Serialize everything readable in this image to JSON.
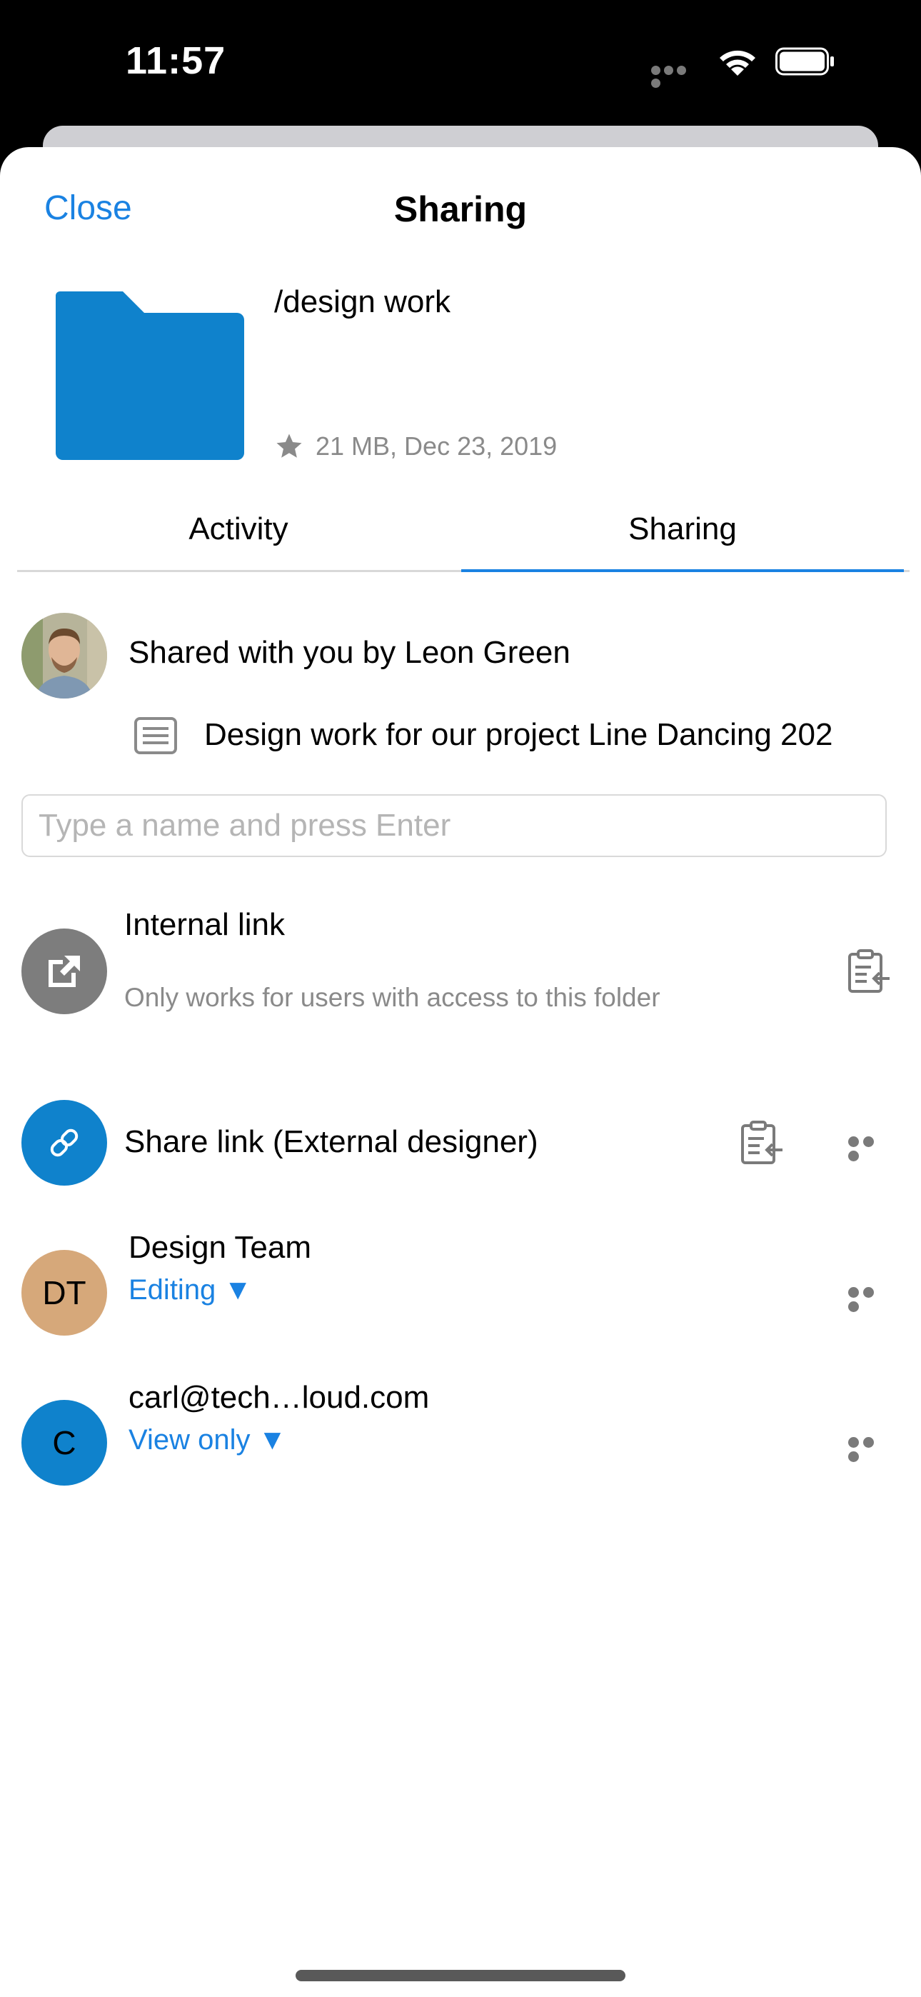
{
  "status_bar": {
    "time": "11:57"
  },
  "header": {
    "close_label": "Close",
    "title": "Sharing"
  },
  "file": {
    "name": "/design work",
    "meta": "21 MB, Dec 23, 2019",
    "folder_color": "#0f82cc"
  },
  "tabs": [
    {
      "label": "Activity",
      "selected": false
    },
    {
      "label": "Sharing",
      "selected": true
    }
  ],
  "share_info": {
    "shared_by": "Shared with you by Leon Green",
    "note": "Design work for our project Line Dancing 202"
  },
  "search": {
    "placeholder": "Type a name and press Enter"
  },
  "internal_link": {
    "title": "Internal link",
    "subtitle": "Only works for users with access to this folder"
  },
  "share_link": {
    "label": "Share link (External designer)"
  },
  "shares": [
    {
      "initials": "DT",
      "name": "Design Team",
      "permission": "Editing ▼",
      "avatar_color": "#d6a87a"
    },
    {
      "initials": "C",
      "name": "carl@tech…loud.com",
      "permission": "View only ▼",
      "avatar_color": "#0f82cc"
    }
  ],
  "colors": {
    "accent": "#1a82e2",
    "muted": "#8a8a8a"
  }
}
